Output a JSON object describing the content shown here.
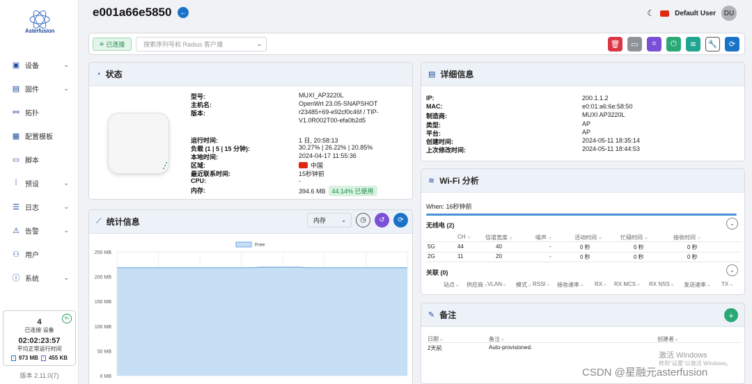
{
  "brand": {
    "logo_text": "Asterfusion"
  },
  "sidebar": {
    "items": [
      {
        "label": "设备",
        "icon": "devices-icon",
        "glyph": "▣",
        "chevron": true
      },
      {
        "label": "固件",
        "icon": "firmware-icon",
        "glyph": "▤",
        "chevron": true
      },
      {
        "label": "拓扑",
        "icon": "topology-icon",
        "glyph": "⚯",
        "chevron": false
      },
      {
        "label": "配置模板",
        "icon": "template-icon",
        "glyph": "▦",
        "chevron": false
      },
      {
        "label": "脚本",
        "icon": "script-icon",
        "glyph": "▭",
        "chevron": false
      },
      {
        "label": "预设",
        "icon": "preset-icon",
        "glyph": "⁞",
        "chevron": true
      },
      {
        "label": "日志",
        "icon": "log-icon",
        "glyph": "☰",
        "chevron": true
      },
      {
        "label": "告警",
        "icon": "alarm-icon",
        "glyph": "⚠",
        "chevron": true
      },
      {
        "label": "用户",
        "icon": "users-icon",
        "glyph": "⚇",
        "chevron": false
      },
      {
        "label": "系统",
        "icon": "system-icon",
        "glyph": "ⓘ",
        "chevron": true
      }
    ],
    "stats": {
      "count": "4",
      "count_label": "已连接 设备",
      "uptime": "02:02:23:57",
      "uptime_label": "平均正常运行时间",
      "rx": "973 MB",
      "tx": "455 KB",
      "refresh": "6s"
    },
    "version": "版本 2.11.0(7)"
  },
  "header": {
    "title": "e001a66e5850",
    "user": "Default User",
    "avatar": "DU"
  },
  "toolbar": {
    "status": "已连接",
    "search_placeholder": "搜索序列号和 Radius 客户端",
    "buttons": [
      {
        "name": "delete-button",
        "icon": "trash-icon",
        "glyph": "🗑",
        "color": "#dc3545"
      },
      {
        "name": "terminal-button",
        "icon": "terminal-icon",
        "glyph": "▭",
        "color": "#8e9399"
      },
      {
        "name": "scan-button",
        "icon": "scan-icon",
        "glyph": "⌗",
        "color": "#7b4fd6"
      },
      {
        "name": "power-button",
        "icon": "power-icon",
        "glyph": "⏻",
        "color": "#2aa876"
      },
      {
        "name": "wifi-button",
        "icon": "wifi-icon",
        "glyph": "≋",
        "color": "#20a590"
      },
      {
        "name": "wrench-button",
        "icon": "wrench-icon",
        "glyph": "🔧",
        "color": "#ffffff"
      },
      {
        "name": "refresh-button",
        "icon": "refresh-icon",
        "glyph": "⟳",
        "color": "#1a73c8"
      }
    ]
  },
  "status_card": {
    "title": "状态",
    "rows": [
      {
        "k": "型号:",
        "v": "MUXI_AP3220L"
      },
      {
        "k": "主机名:",
        "v": ""
      },
      {
        "k": "版本:",
        "v1": "OpenWrt 23.05-SNAPSHOT",
        "v2": "r23485+69-e92cf0c46f / TIP-",
        "v3": "V1.0R002T00-efa0b2d5"
      },
      {
        "k": "运行时间:",
        "v": "1 日, 20:58:13"
      },
      {
        "k": "负载 (1 | 5 | 15 分钟):",
        "v": "30.27% | 26.22% | 20.85%"
      },
      {
        "k": "本地时间:",
        "v": "2024-04-17 11:55:36"
      },
      {
        "k": "区域:",
        "v": "中国"
      },
      {
        "k": "最近联系时间:",
        "v": "15秒钟前"
      },
      {
        "k": "CPU:",
        "v": "-"
      },
      {
        "k": "内存:",
        "v": "394.6 MB",
        "badge": "44.14% 已使用"
      }
    ]
  },
  "details_card": {
    "title": "详细信息",
    "rows": [
      {
        "k": "IP:",
        "v": "200.1.1.2"
      },
      {
        "k": "MAC:",
        "v": "e0:01:a6:6e:58:50"
      },
      {
        "k": "制造商:",
        "v": "MUXI AP3220L"
      },
      {
        "k": "类型:",
        "v": "AP"
      },
      {
        "k": "平台:",
        "v": "AP"
      },
      {
        "k": "创建时间:",
        "v": "2024-05-11 18:35:14"
      },
      {
        "k": "上次修改时间:",
        "v": "2024-05-11 18:44:53"
      }
    ]
  },
  "stats_card": {
    "title": "统计信息",
    "select": "内存"
  },
  "chart_data": {
    "type": "area",
    "series": [
      {
        "name": "Free",
        "values": [
          218,
          218,
          218,
          218,
          218,
          218,
          218,
          218,
          218,
          218,
          218,
          218,
          218,
          218,
          218,
          218,
          218,
          218,
          218,
          218,
          218,
          218,
          218,
          218,
          219,
          219,
          219,
          219,
          219,
          219,
          219,
          219,
          218,
          218,
          218,
          218,
          218,
          218,
          218,
          218,
          218,
          218,
          218,
          218,
          218,
          218,
          218,
          218,
          218,
          218
        ]
      }
    ],
    "y_ticks": [
      "250 MB",
      "200 MB",
      "150 MB",
      "100 MB",
      "50 MB",
      "0 MB"
    ],
    "ylim": [
      0,
      250
    ],
    "grid": true,
    "legend_position": "top-center"
  },
  "wifi_card": {
    "title": "Wi-Fi 分析",
    "when": "When: 16秒钟前",
    "radio_title": "无线电 (2)",
    "radio_headers": [
      "CH",
      "信道宽度",
      "噪声",
      "活动时间",
      "忙碌时间",
      "接收时间"
    ],
    "radios": [
      {
        "band": "5G",
        "ch": "44",
        "width": "40",
        "noise": "-",
        "active": "0 秒",
        "busy": "0 秒",
        "rx": "0 秒"
      },
      {
        "band": "2G",
        "ch": "11",
        "width": "20",
        "noise": "-",
        "active": "0 秒",
        "busy": "0 秒",
        "rx": "0 秒"
      }
    ],
    "assoc_title": "关联 (0)",
    "assoc_headers": [
      "站点",
      "供应商",
      "VLAN",
      "模式",
      "RSSI",
      "接收速率",
      "RX",
      "RX MCS",
      "RX NSS",
      "发送速率",
      "TX"
    ]
  },
  "notes_card": {
    "title": "备注",
    "headers": [
      "日期",
      "备注",
      "创建者"
    ],
    "rows": [
      {
        "date": "2天前",
        "note": "Auto-provisioned.",
        "creator": ""
      }
    ]
  },
  "watermark": {
    "line1": "激活 Windows",
    "line2": "转到\"设置\"以激活 Windows。",
    "line3": "CSDN @星融元asterfusion"
  },
  "colors": {
    "primary": "#1a4a9c",
    "accent": "#1a73c8",
    "success": "#2aa876"
  }
}
